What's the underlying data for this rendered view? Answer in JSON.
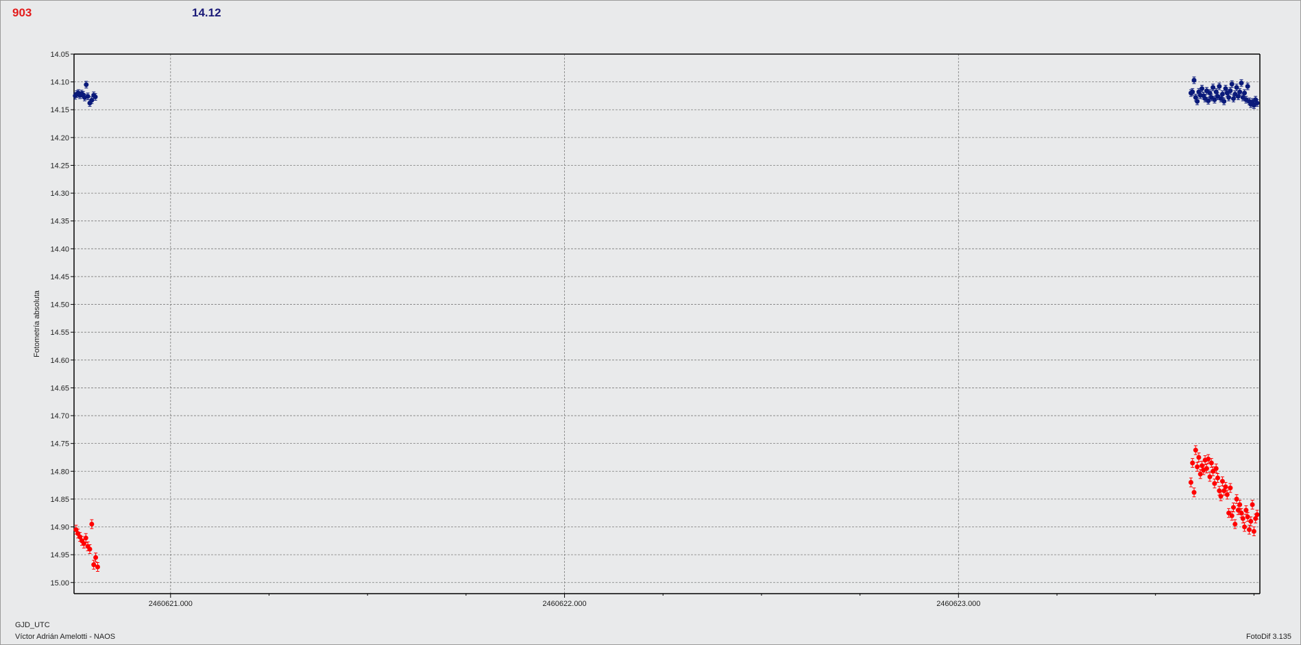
{
  "header": {
    "left_value": "903",
    "right_value": "14.12"
  },
  "footer": {
    "x_label": "GJD_UTC",
    "observer": "Víctor Adrián Amelotti - NAOS",
    "software": "FotoDif 3.135"
  },
  "colors": {
    "series_a": "#ff0000",
    "series_b": "#0a1a7a",
    "grid": "#7a7a7a",
    "axis": "#000000"
  },
  "chart_data": {
    "type": "scatter",
    "title": "",
    "xlabel": "GJD_UTC",
    "ylabel": "Fotometría absoluta",
    "xlim": [
      2460620.755,
      2460623.765
    ],
    "ylim": [
      14.05,
      15.02
    ],
    "y_inverted": true,
    "grid": true,
    "x_ticks": [
      2460621.0,
      2460622.0,
      2460623.0
    ],
    "x_tick_labels": [
      "2460621.000",
      "2460622.000",
      "2460623.000"
    ],
    "y_ticks": [
      14.05,
      14.1,
      14.15,
      14.2,
      14.25,
      14.3,
      14.35,
      14.4,
      14.45,
      14.5,
      14.55,
      14.6,
      14.65,
      14.7,
      14.75,
      14.8,
      14.85,
      14.9,
      14.95,
      15.0
    ],
    "y_tick_labels": [
      "14.05",
      "14.10",
      "14.15",
      "14.20",
      "14.25",
      "14.30",
      "14.35",
      "14.40",
      "14.45",
      "14.50",
      "14.55",
      "14.60",
      "14.65",
      "14.70",
      "14.75",
      "14.80",
      "14.85",
      "14.90",
      "14.95",
      "15.00"
    ],
    "series": [
      {
        "color": "#0a1a7a",
        "error": 0.006,
        "x": [
          2460620.758,
          2460620.762,
          2460620.766,
          2460620.77,
          2460620.774,
          2460620.778,
          2460620.782,
          2460620.786,
          2460620.79,
          2460620.795,
          2460620.8,
          2460620.805,
          2460620.809,
          2460623.59,
          2460623.594,
          2460623.598,
          2460623.602,
          2460623.606,
          2460623.61,
          2460623.614,
          2460623.618,
          2460623.622,
          2460623.626,
          2460623.63,
          2460623.634,
          2460623.638,
          2460623.642,
          2460623.646,
          2460623.65,
          2460623.654,
          2460623.658,
          2460623.662,
          2460623.666,
          2460623.67,
          2460623.674,
          2460623.678,
          2460623.682,
          2460623.686,
          2460623.69,
          2460623.694,
          2460623.698,
          2460623.702,
          2460623.706,
          2460623.71,
          2460623.714,
          2460623.718,
          2460623.722,
          2460623.726,
          2460623.73,
          2460623.734,
          2460623.738,
          2460623.742,
          2460623.746,
          2460623.75,
          2460623.754,
          2460623.758
        ],
        "y": [
          14.125,
          14.122,
          14.12,
          14.124,
          14.121,
          14.123,
          14.128,
          14.105,
          14.126,
          14.138,
          14.133,
          14.124,
          14.127,
          14.12,
          14.118,
          14.097,
          14.128,
          14.135,
          14.118,
          14.124,
          14.112,
          14.125,
          14.13,
          14.116,
          14.134,
          14.12,
          14.128,
          14.11,
          14.132,
          14.118,
          14.126,
          14.108,
          14.13,
          14.122,
          14.135,
          14.112,
          14.12,
          14.128,
          14.116,
          14.104,
          14.13,
          14.122,
          14.11,
          14.126,
          14.118,
          14.102,
          14.128,
          14.12,
          14.132,
          14.108,
          14.135,
          14.14,
          14.136,
          14.142,
          14.132,
          14.138
        ]
      },
      {
        "color": "#ff0000",
        "error": 0.008,
        "x": [
          2460620.76,
          2460620.765,
          2460620.77,
          2460620.775,
          2460620.78,
          2460620.785,
          2460620.79,
          2460620.795,
          2460620.8,
          2460620.805,
          2460620.81,
          2460620.815,
          2460623.59,
          2460623.594,
          2460623.598,
          2460623.602,
          2460623.606,
          2460623.61,
          2460623.614,
          2460623.618,
          2460623.622,
          2460623.626,
          2460623.63,
          2460623.634,
          2460623.638,
          2460623.642,
          2460623.646,
          2460623.65,
          2460623.654,
          2460623.658,
          2460623.662,
          2460623.666,
          2460623.67,
          2460623.674,
          2460623.678,
          2460623.682,
          2460623.686,
          2460623.69,
          2460623.694,
          2460623.698,
          2460623.702,
          2460623.706,
          2460623.71,
          2460623.714,
          2460623.718,
          2460623.722,
          2460623.726,
          2460623.73,
          2460623.734,
          2460623.738,
          2460623.742,
          2460623.746,
          2460623.75,
          2460623.754,
          2460623.758
        ],
        "y": [
          14.905,
          14.912,
          14.918,
          14.925,
          14.93,
          14.92,
          14.935,
          14.94,
          14.895,
          14.968,
          14.955,
          14.972,
          14.82,
          14.785,
          14.838,
          14.762,
          14.792,
          14.775,
          14.805,
          14.79,
          14.798,
          14.78,
          14.795,
          14.778,
          14.81,
          14.785,
          14.8,
          14.822,
          14.795,
          14.812,
          14.835,
          14.845,
          14.818,
          14.835,
          14.828,
          14.842,
          14.875,
          14.83,
          14.88,
          14.865,
          14.895,
          14.85,
          14.87,
          14.86,
          14.875,
          14.885,
          14.9,
          14.87,
          14.882,
          14.905,
          14.89,
          14.86,
          14.908,
          14.885,
          14.878
        ]
      }
    ]
  }
}
